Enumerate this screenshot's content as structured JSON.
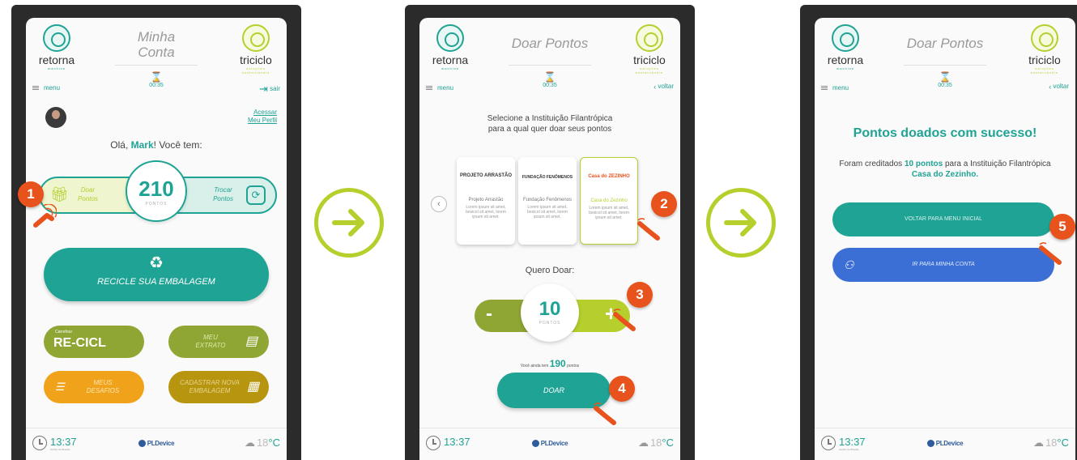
{
  "header": {
    "logo_left": {
      "name": "retorna",
      "sub": "machine"
    },
    "logo_right": {
      "name": "triciclo",
      "sub": "soluções sustentáveis"
    },
    "timer": "00:35"
  },
  "footer": {
    "time": "13:37",
    "time_sub": "horário de Brasília",
    "brand": "PLDevice",
    "temp_value": "18",
    "temp_unit": "°C"
  },
  "screen1": {
    "title_line1": "Minha",
    "title_line2": "Conta",
    "menu": "menu",
    "exit": "sair",
    "profile_line1": "Acessar",
    "profile_line2": "Meu Perfil",
    "greet_prefix": "Olá, ",
    "greet_name": "Mark",
    "greet_suffix": "! Você tem:",
    "points": "210",
    "points_unit": "PONTOS",
    "donate_line1": "Doar",
    "donate_line2": "Pontos",
    "trade_line1": "Trocar",
    "trade_line2": "Pontos",
    "recycle": "RECICLE SUA EMBALAGEM",
    "reciclo_small": "Carrefour",
    "reciclo_big": "RE-CICL",
    "extrato_line1": "MEU",
    "extrato_line2": "EXTRATO",
    "desafios_line1": "MEUS",
    "desafios_line2": "DESAFIOS",
    "cadastrar_line1": "CADASTRAR NOVA",
    "cadastrar_line2": "EMBALAGEM"
  },
  "screen2": {
    "title": "Doar Pontos",
    "menu": "menu",
    "back": "voltar",
    "instruction_line1": "Selecione a Instituição Filantrópica",
    "instruction_line2": "para a qual quer doar seus pontos",
    "cards": [
      {
        "logo": "PROJETO ARRASTÃO",
        "name": "Projeto Arrastão",
        "desc": "Lorem ipsum sit amet, besicol sit amet, lorem ipsum sit amet."
      },
      {
        "logo": "FUNDAÇÃO FENÔMENOS",
        "name": "Fundação Fenômenos",
        "desc": "Lorem ipsum sit amet, besicol sit amet, lorem ipsum sit amet."
      },
      {
        "logo": "Casa do ZEZINHO",
        "name": "Casa do Zezinho",
        "desc": "Lorem ipsum sit amet, besicol sit amet, lorem ipsum sit amet."
      }
    ],
    "quero": "Quero Doar:",
    "minus": "-",
    "plus": "+",
    "amount": "10",
    "amount_unit": "PONTOS",
    "remain_prefix": "Você ainda tem ",
    "remain_value": "190",
    "remain_suffix": " pontos",
    "donate_button": "DOAR"
  },
  "screen3": {
    "title": "Doar Pontos",
    "menu": "menu",
    "back": "voltar",
    "success": "Pontos doados com sucesso!",
    "msg_prefix": "Foram creditados ",
    "msg_points": "10 pontos",
    "msg_mid": " para a Instituição Filantrópica ",
    "msg_inst": "Casa do Zezinho.",
    "btn_menu": "VOLTAR PARA MENU INICIAL",
    "btn_account": "IR PARA MINHA CONTA"
  },
  "markers": [
    "1",
    "2",
    "3",
    "4",
    "5"
  ],
  "colors": {
    "teal": "#1fa394",
    "lime": "#b6cf2d",
    "olive": "#8fa634",
    "orange": "#f0a31a",
    "gold": "#b8950e",
    "blue": "#3b6fd6",
    "marker": "#e8521c"
  }
}
